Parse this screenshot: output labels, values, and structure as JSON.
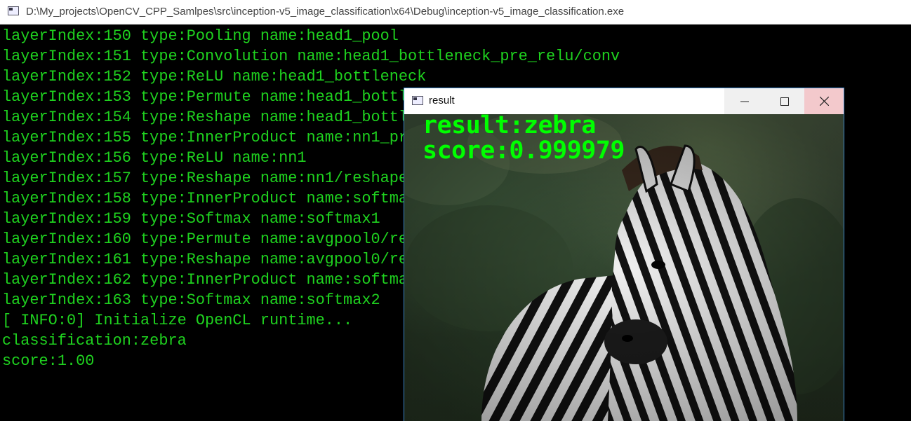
{
  "console": {
    "title": "D:\\My_projects\\OpenCV_CPP_Samlpes\\src\\inception-v5_image_classification\\x64\\Debug\\inception-v5_image_classification.exe",
    "lines": [
      "layerIndex:150 type:Pooling name:head1_pool",
      "layerIndex:151 type:Convolution name:head1_bottleneck_pre_relu/conv",
      "layerIndex:152 type:ReLU name:head1_bottleneck",
      "layerIndex:153 type:Permute name:head1_bottl",
      "layerIndex:154 type:Reshape name:head1_bottl",
      "layerIndex:155 type:InnerProduct name:nn1_pr",
      "layerIndex:156 type:ReLU name:nn1",
      "layerIndex:157 type:Reshape name:nn1/reshape",
      "layerIndex:158 type:InnerProduct name:softmax",
      "layerIndex:159 type:Softmax name:softmax1",
      "layerIndex:160 type:Permute name:avgpool0/re",
      "layerIndex:161 type:Reshape name:avgpool0/re",
      "layerIndex:162 type:InnerProduct name:softmax",
      "layerIndex:163 type:Softmax name:softmax2",
      "[ INFO:0] Initialize OpenCL runtime...",
      "classification:zebra",
      "score:1.00"
    ],
    "text_color": "#1fd21f"
  },
  "result_window": {
    "title": "result",
    "overlay_result": "result:zebra",
    "overlay_score": "score:0.999979",
    "overlay_color": "#00ff00",
    "buttons": [
      "minimize",
      "maximize",
      "close"
    ]
  },
  "icons": {
    "console": "console-app-icon",
    "result": "opencv-window-icon",
    "minimize": "minimize-icon",
    "maximize": "maximize-icon",
    "close": "close-icon"
  }
}
